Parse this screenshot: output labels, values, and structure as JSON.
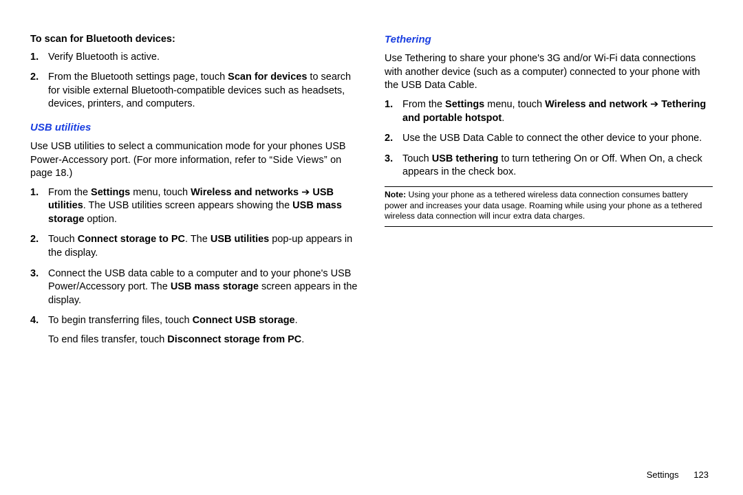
{
  "left": {
    "scan_head": "To scan for Bluetooth devices:",
    "scan": {
      "i1": "Verify Bluetooth is active.",
      "i2_a": "From the Bluetooth settings page, touch ",
      "i2_b": "Scan for devices",
      "i2_c": " to search for visible external Bluetooth-compatible devices such as headsets, devices, printers, and computers."
    },
    "usb_head": "USB utilities",
    "usb_intro_a": "Use USB utilities to select a communication mode for your phones USB Power-Accessory port. (For more information, refer to ",
    "usb_intro_b": "“Side Views”",
    "usb_intro_c": " on page 18.)",
    "usb": {
      "i1_a": "From the ",
      "i1_b": "Settings",
      "i1_c": " menu, touch ",
      "i1_d": "Wireless and networks",
      "i1_e": " ➔ ",
      "i1_f": "USB utilities",
      "i1_g": ". The USB utilities screen appears showing the ",
      "i1_h": "USB mass storage",
      "i1_i": " option.",
      "i2_a": "Touch ",
      "i2_b": "Connect storage to PC",
      "i2_c": ". The ",
      "i2_d": "USB utilities",
      "i2_e": " pop-up appears in the display.",
      "i3_a": "Connect the USB data cable to a computer and to your phone's USB Power/Accessory port. The ",
      "i3_b": "USB mass storage",
      "i3_c": " screen appears in the display.",
      "i4_a": "To begin transferring files, touch ",
      "i4_b": "Connect USB storage",
      "i4_c": ".",
      "i4_d": "To end files transfer, touch ",
      "i4_e": "Disconnect storage from PC",
      "i4_f": "."
    }
  },
  "right": {
    "teth_head": "Tethering",
    "teth_intro": "Use Tethering to share your phone's 3G and/or Wi-Fi data connections with another device (such as a computer) connected to your phone with the USB Data Cable.",
    "teth": {
      "i1_a": "From the ",
      "i1_b": "Settings",
      "i1_c": " menu, touch ",
      "i1_d": "Wireless and network",
      "i1_e": " ➔ ",
      "i1_f": "Tethering and portable hotspot",
      "i1_g": ".",
      "i2": "Use the USB Data Cable to connect the other device to your phone.",
      "i3_a": "Touch ",
      "i3_b": "USB tethering",
      "i3_c": " to turn tethering On or Off. When On, a check appears in the check box."
    },
    "note_label": "Note:",
    "note_body": "Using your phone as a tethered wireless data connection consumes battery power and increases your data usage. Roaming while using your phone as a tethered wireless data connection will incur extra data charges."
  },
  "footer": {
    "section": "Settings",
    "page": "123"
  }
}
